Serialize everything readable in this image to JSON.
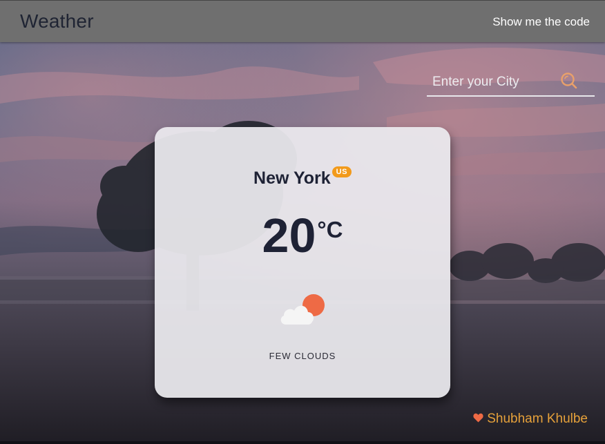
{
  "header": {
    "brand": "Weather",
    "code_link": "Show me the code"
  },
  "search": {
    "placeholder": "Enter your City",
    "icon": "search-icon"
  },
  "card": {
    "city": "New York",
    "country": "US",
    "temperature": "20",
    "unit": "°C",
    "icon": "few-clouds-icon",
    "description": "FEW CLOUDS"
  },
  "footer": {
    "credit": "Shubham Khulbe",
    "icon": "heart-icon"
  },
  "colors": {
    "header_bg": "#6f6f6f",
    "accent_orange": "#f29a1b",
    "credit_color": "#e6a13a",
    "sun_color": "#ee6a45",
    "text_dark": "#1e2235"
  }
}
